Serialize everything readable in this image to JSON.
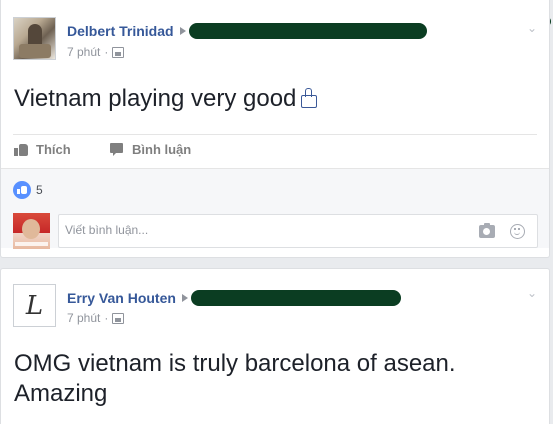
{
  "posts": [
    {
      "author": "Delbert Trinidad",
      "time": "7 phút",
      "text": "Vietnam playing very good",
      "actions": {
        "like": "Thích",
        "comment": "Bình luận"
      },
      "reactions": {
        "count": "5"
      },
      "comment_placeholder": "Viết bình luận..."
    },
    {
      "author": "Erry Van Houten",
      "time": "7 phút",
      "avatar_letter": "L",
      "text": "OMG vietnam is truly barcelona of asean. Amazing"
    }
  ],
  "colors": {
    "author_link": "#365899",
    "reaction_like": "#5890ff",
    "page_bg": "#e9ebee"
  }
}
